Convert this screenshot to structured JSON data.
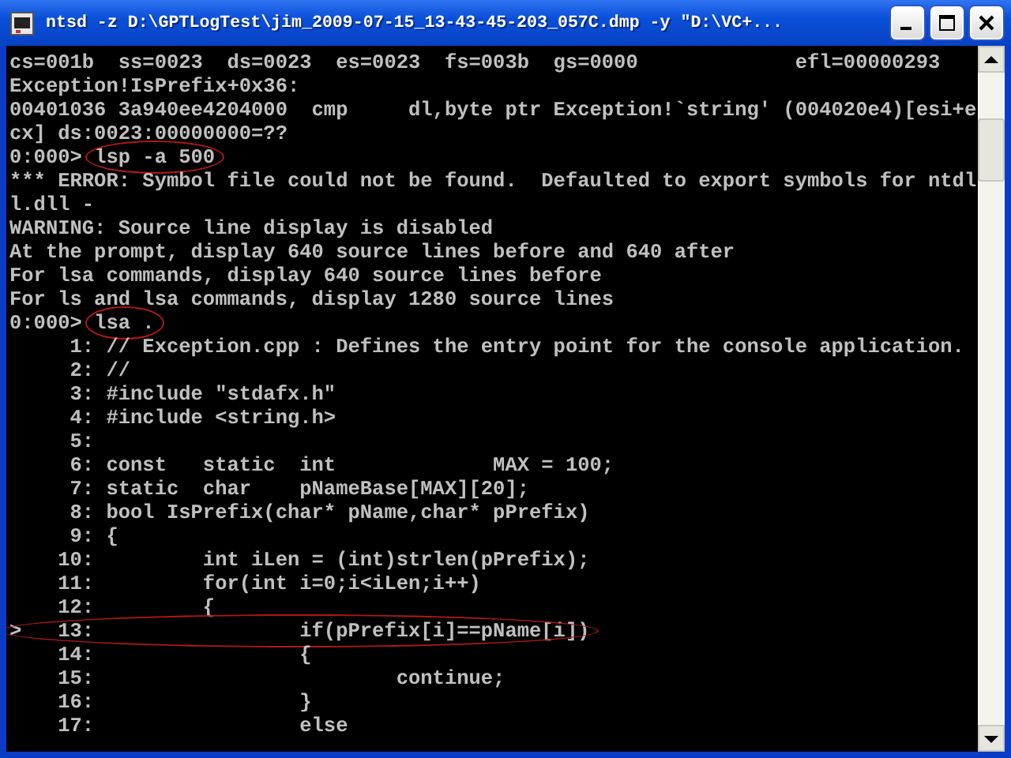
{
  "window": {
    "title": "ntsd -z D:\\GPTLogTest\\jim_2009-07-15_13-43-45-203_057C.dmp -y \"D:\\VC+..."
  },
  "console": {
    "lines": [
      {
        "text": "cs=001b  ss=0023  ds=0023  es=0023  fs=003b  gs=0000             efl=00000293",
        "circled": false
      },
      {
        "text": "Exception!IsPrefix+0x36:",
        "circled": false
      },
      {
        "text": "00401036 3a940ee4204000  cmp     dl,byte ptr Exception!`string' (004020e4)[esi+e",
        "circled": false
      },
      {
        "text": "cx] ds:0023:00000000=??",
        "circled": false
      },
      {
        "prompt": "0:000> ",
        "text": "lsp -a 500",
        "circled": true
      },
      {
        "text": "*** ERROR: Symbol file could not be found.  Defaulted to export symbols for ntdl",
        "circled": false
      },
      {
        "text": "l.dll - ",
        "circled": false
      },
      {
        "text": "WARNING: Source line display is disabled",
        "circled": false
      },
      {
        "text": "At the prompt, display 640 source lines before and 640 after",
        "circled": false
      },
      {
        "text": "For lsa commands, display 640 source lines before",
        "circled": false
      },
      {
        "text": "For ls and lsa commands, display 1280 source lines",
        "circled": false
      },
      {
        "prompt": "0:000> ",
        "text": "lsa .",
        "circled": true
      },
      {
        "text": "     1: // Exception.cpp : Defines the entry point for the console application.",
        "circled": false
      },
      {
        "text": "     2: //",
        "circled": false
      },
      {
        "text": "     3: #include \"stdafx.h\"",
        "circled": false
      },
      {
        "text": "     4: #include <string.h>",
        "circled": false
      },
      {
        "text": "     5: ",
        "circled": false
      },
      {
        "text": "     6: const   static  int             MAX = 100;",
        "circled": false
      },
      {
        "text": "     7: static  char    pNameBase[MAX][20];",
        "circled": false
      },
      {
        "text": "     8: bool IsPrefix(char* pName,char* pPrefix)",
        "circled": false
      },
      {
        "text": "     9: {",
        "circled": false
      },
      {
        "text": "    10:         int iLen = (int)strlen(pPrefix);",
        "circled": false
      },
      {
        "text": "    11:         for(int i=0;i<iLen;i++)",
        "circled": false
      },
      {
        "text": "    12:         {",
        "circled": false
      },
      {
        "text": ">   13:                 if(pPrefix[i]==pName[i])",
        "circled": true
      },
      {
        "text": "    14:                 {",
        "circled": false
      },
      {
        "text": "    15:                         continue;",
        "circled": false
      },
      {
        "text": "    16:                 }",
        "circled": false
      },
      {
        "text": "    17:                 else",
        "circled": false
      }
    ]
  }
}
